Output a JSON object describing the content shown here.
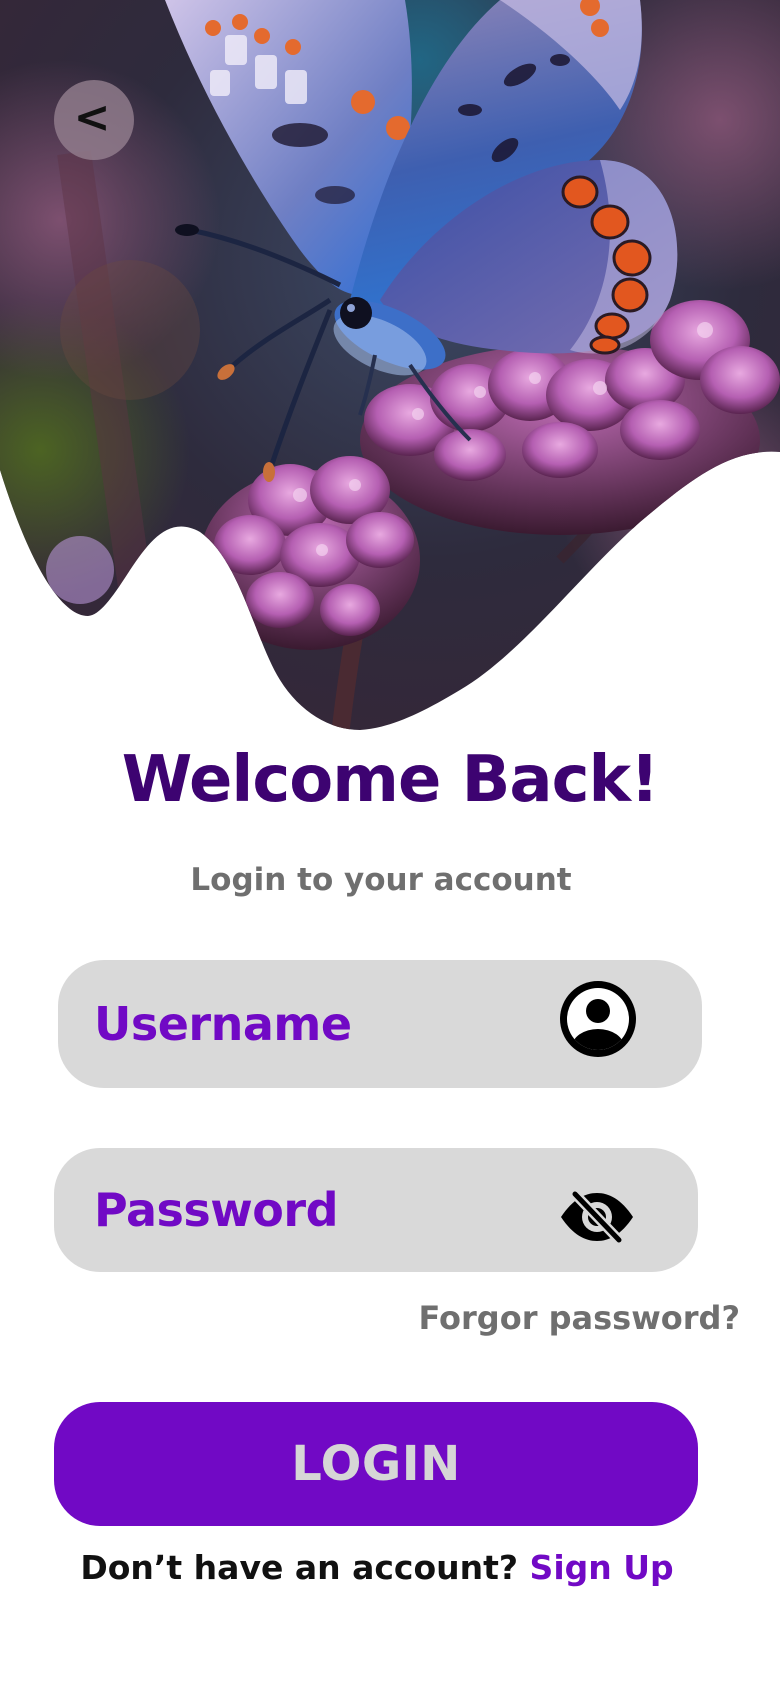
{
  "colors": {
    "brand_purple": "#7109c5",
    "title_purple": "#3d0371",
    "muted_gray": "#6f6f6f",
    "field_background": "#d9d9d9",
    "button_text": "#d6d6d6"
  },
  "hero": {
    "image": "butterfly-on-flower-photo",
    "back_label": "<"
  },
  "header": {
    "title": "Welcome Back!",
    "subtitle": "Login to your account"
  },
  "form": {
    "username": {
      "placeholder": "Username",
      "value": "",
      "icon": "user-circle-icon"
    },
    "password": {
      "placeholder": "Password",
      "value": "",
      "icon": "eye-slash-icon"
    },
    "forgot_label": "Forgor password?",
    "login_label": "LOGIN"
  },
  "footer": {
    "signup_prompt": "Don’t have an account?",
    "signup_link": "Sign Up"
  }
}
